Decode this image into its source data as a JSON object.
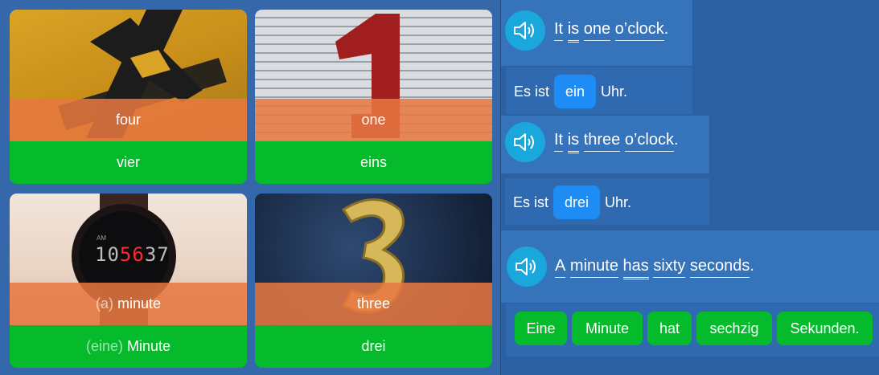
{
  "cards": [
    {
      "english": "four",
      "german": "vier"
    },
    {
      "english": "one",
      "german": "eins"
    },
    {
      "english_article": "(a)",
      "english": "minute",
      "german_article": "(eine)",
      "german": "Minute"
    },
    {
      "english": "three",
      "german": "drei"
    }
  ],
  "watch": {
    "time_hours": "10",
    "time_minutes": "56",
    "time_seconds": "37",
    "am": "AM"
  },
  "exercises": [
    {
      "english_words": [
        "It",
        "is",
        "one",
        "o’clock"
      ],
      "english_end": ".",
      "german_before": "Es ist",
      "german_answer": "ein",
      "german_after": "Uhr."
    },
    {
      "english_words": [
        "It",
        "is",
        "three",
        "o’clock"
      ],
      "english_end": ".",
      "german_before": "Es ist",
      "german_answer": "drei",
      "german_after": "Uhr."
    },
    {
      "english_words": [
        "A",
        "minute",
        "has",
        "sixty",
        "seconds"
      ],
      "english_end": ".",
      "word_chips": [
        "Eine",
        "Minute",
        "hat",
        "sechzig",
        "Sekunden."
      ]
    }
  ],
  "icons": {
    "speaker": "speaker-icon"
  },
  "colors": {
    "green": "#05bb2c",
    "orange_overlay": "#e87840",
    "blue_pill": "#1e8cf5",
    "speaker_bg": "#19a7dc",
    "background": "#2f65a8"
  }
}
